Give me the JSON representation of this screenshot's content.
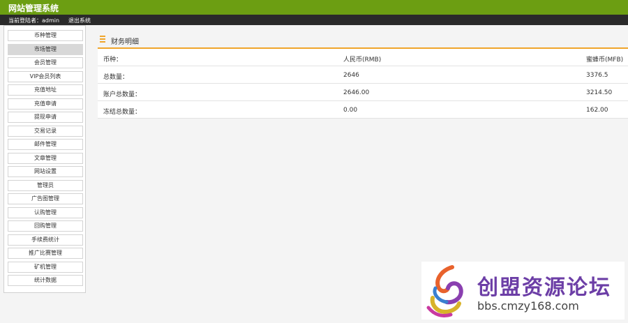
{
  "header": {
    "title": "网站管理系统"
  },
  "subbar": {
    "current_user": "当前登陆者：admin",
    "logout_label": "退出系统"
  },
  "sidebar": {
    "items": [
      {
        "label": "币种管理"
      },
      {
        "label": "市场管理"
      },
      {
        "label": "会员管理"
      },
      {
        "label": "VIP会员列表"
      },
      {
        "label": "充值地址"
      },
      {
        "label": "充值申请"
      },
      {
        "label": "提现申请"
      },
      {
        "label": "交易记录"
      },
      {
        "label": "邮件管理"
      },
      {
        "label": "文章管理"
      },
      {
        "label": "网站设置"
      },
      {
        "label": "管理员"
      },
      {
        "label": "广告图管理"
      },
      {
        "label": "认购管理"
      },
      {
        "label": "回购管理"
      },
      {
        "label": "手续费统计"
      },
      {
        "label": "推广比赛管理"
      },
      {
        "label": "矿机管理"
      },
      {
        "label": "统计数据"
      }
    ],
    "active_index": 1
  },
  "panel": {
    "title": "财务明细"
  },
  "table": {
    "headers": [
      "币种：",
      "人民币(RMB)",
      "蜜蜂币(MFB)"
    ],
    "rows": [
      [
        "总数量：",
        "2646",
        "3376.5"
      ],
      [
        "账户总数量：",
        "2646.00",
        "3214.50"
      ],
      [
        "冻结总数量：",
        "0.00",
        "162.00"
      ]
    ]
  },
  "watermark": {
    "text_cn": "创盟资源论坛",
    "url": "bbs.cmzy168.com"
  },
  "colors": {
    "header_green": "#6c9e12",
    "accent_orange": "#f0a52b",
    "subbar_dark": "#2a2a2a"
  }
}
